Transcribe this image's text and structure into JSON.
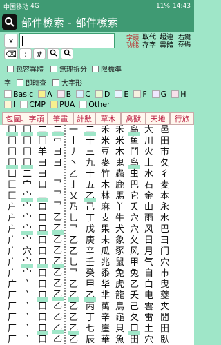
{
  "statusbar": {
    "carrier": "中国移动",
    "signal": "4G",
    "battery": "11%",
    "time": "14:43"
  },
  "app": {
    "title": "部件檢索 - 部件檢索"
  },
  "toolbar": {
    "x_label": "x",
    "backspace_label": "⌫",
    "colon_label": ":",
    "hash_label": "#",
    "prefs_label": "字頭\n功能",
    "take_label": "取代",
    "save_label": "存字",
    "beyond_label": "超連",
    "variant_label": "異體",
    "right_label": "右鍵",
    "store_label": "存碼"
  },
  "options": {
    "include_variant": "包容異體",
    "no_split": "無理拆分",
    "limit_std": "限標準",
    "word_label": "字",
    "instant": "即時查",
    "big": "大字形"
  },
  "legend": {
    "basic": "Basic",
    "A": "A",
    "B": "B",
    "C": "C",
    "D": "D",
    "E": "E",
    "F": "F",
    "G": "G",
    "H": "H",
    "I": "I",
    "CMP": "CMP",
    "PUA": "PUA",
    "other": "Other",
    "colors": {
      "basic": "#ffffff",
      "A": "#f7f08e",
      "B": "#f7e6f2",
      "C": "#d8f0ff",
      "D": "#e9f7d1",
      "E": "#e9f3ff",
      "F": "#f7f0e0",
      "G": "#f0e7ff",
      "H": "#f7e0ea",
      "I": "#fff6d5",
      "CMP": "#ffffff",
      "PUA": "#f7f08e",
      "other": "#ffffff"
    }
  },
  "tabs": [
    "包圍、字頭",
    "筆畫",
    "計數",
    "草木",
    "禽獸",
    "天地",
    "行旅"
  ],
  "columns": [
    [
      "冂",
      "冂",
      "冂",
      "冂",
      "凵",
      "匚",
      "匚",
      "户",
      "户",
      "户",
      "广",
      "广",
      "广",
      "广",
      "广",
      "厂",
      "厂",
      "厂",
      "厂",
      "厂"
    ],
    [
      "冂",
      "冂",
      "冂",
      "冂",
      "二",
      "宀",
      "宀",
      "宀",
      "宀",
      "宀",
      "宀",
      "穴",
      "宀",
      "宀",
      "亠",
      "亠",
      "亠",
      "亠",
      "亠",
      "亠"
    ],
    [
      "二",
      "冂",
      "羊",
      "彐",
      "彐",
      "口",
      "二",
      "口",
      "口",
      "口",
      "口",
      "口",
      "口",
      "口",
      "口",
      "口",
      "口",
      "口",
      "口",
      "口"
    ],
    [
      "二",
      "冖",
      "彐",
      "彐",
      "",
      "乛",
      "乛",
      "乛",
      "乙",
      "乙",
      "乙",
      "乙",
      "乙",
      "乙",
      "乙",
      "乙",
      "乙",
      "乙",
      "乙",
      "乙"
    ],
    [
      "一",
      "丨",
      "丿",
      "丶",
      "乙",
      "亅",
      "乂",
      "乃",
      "乚",
      "乛",
      "乙",
      "乙",
      "乚",
      "乛",
      "乙",
      "乙",
      "乙",
      "乙",
      "乙",
      "乙"
    ],
    [
      "二",
      "十",
      "三",
      "九",
      "十",
      "五",
      "乙",
      "己",
      "丁",
      "戊",
      "庚",
      "辛",
      "壬",
      "癸",
      "甲",
      "乙",
      "丙",
      "丁",
      "七",
      "辰"
    ],
    [
      "禾",
      "米",
      "豆",
      "麥",
      "竹",
      "木",
      "林",
      "麻",
      "支",
      "果",
      "未",
      "瓜",
      "兆",
      "黍",
      "华",
      "芈",
      "萬",
      "辛",
      "崖",
      "華"
    ],
    [
      "禾",
      "米",
      "木",
      "鬼",
      "蟲",
      "鹿",
      "馬",
      "羊",
      "牛",
      "犬",
      "象",
      "豕",
      "鼠",
      "兔",
      "虎",
      "龍",
      "鳥",
      "龜",
      "貝",
      "魚"
    ],
    [
      "鸟",
      "鱼",
      "鬥",
      "鸟",
      "虫",
      "巴",
      "它",
      "夭",
      "穴",
      "穴",
      "夂",
      "风",
      "甲",
      "兔",
      "乙",
      "夭",
      "己",
      "夂",
      "口",
      "田"
    ],
    [
      "大",
      "川",
      "火",
      "土",
      "水",
      "石",
      "金",
      "山",
      "雨",
      "风",
      "日",
      "月",
      "气",
      "自",
      "白",
      "电",
      "雲",
      "雷",
      "土",
      "穴"
    ],
    [
      "邑",
      "田",
      "市",
      "夂",
      "彳",
      "麦",
      "本",
      "永",
      "水",
      "巴",
      "彐",
      "门",
      "穴",
      "市",
      "曳",
      "夔",
      "夹",
      "閒",
      "田",
      "臥"
    ]
  ],
  "highlights": [
    "冂",
    "宀",
    "口",
    "乙",
    "二",
    "木",
    "鸟",
    "水"
  ]
}
